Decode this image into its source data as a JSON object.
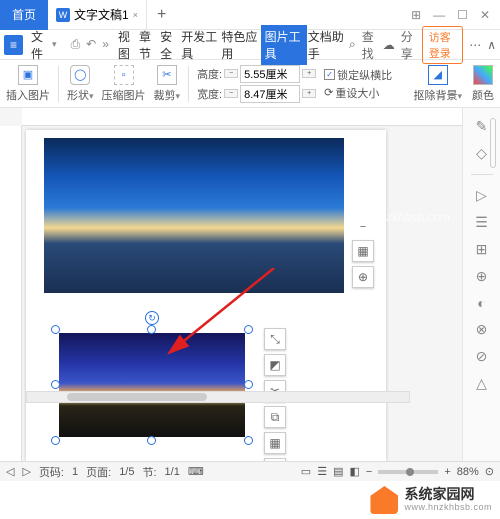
{
  "titlebar": {
    "home_tab": "首页",
    "doc_icon": "W",
    "doc_name": "文字文稿1",
    "add": "+",
    "win": {
      "msg": "⊞",
      "min": "—",
      "max": "☐",
      "close": "✕"
    }
  },
  "menubar": {
    "menu_icon": "≡",
    "file": "文件",
    "tabs": [
      "视图",
      "章节",
      "安全",
      "开发工具",
      "特色应用",
      "图片工具",
      "文档助手"
    ],
    "active_index": 5,
    "search_icon": "⌕",
    "search_label": "查找",
    "cloud_icon": "☁",
    "share": "分享",
    "login": "访客登录",
    "more1": "⋯",
    "more2": "∧"
  },
  "ribbon": {
    "insert_pic": "插入图片",
    "shape": "形状",
    "compress": "压缩图片",
    "crop": "裁剪",
    "height_label": "高度:",
    "width_label": "宽度:",
    "height_val": "5.55厘米",
    "width_val": "8.47厘米",
    "lock_ratio": "锁定纵横比",
    "reset_size": "重设大小",
    "remove_bg": "抠除背景",
    "color": "颜色"
  },
  "img2_tools": [
    "⤡",
    "◩",
    "✂",
    "⧉",
    "▦",
    "⊕"
  ],
  "img1_float": {
    "minus": "−",
    "layout": "▦",
    "plus": "⊕"
  },
  "right_rail": [
    "✎",
    "◇",
    "▷",
    "☰",
    "⊞",
    "⊕",
    "◐",
    "⊗",
    "⊘",
    "△"
  ],
  "status": {
    "page_label": "页码:",
    "page_val": "1",
    "page_count_label": "页面:",
    "page_count_val": "1/5",
    "section_label": "节:",
    "section_val": "1/1",
    "ime": "⌨",
    "views": [
      "▭",
      "☰",
      "▤",
      "◧"
    ],
    "zoom_minus": "−",
    "zoom_plus": "+",
    "zoom": "88%",
    "indicator": "⊙"
  },
  "watermark": {
    "zh": "系统家园网",
    "en": "www.hnzkhbsb.com",
    "overlay": "hnzkhbsb.com"
  }
}
